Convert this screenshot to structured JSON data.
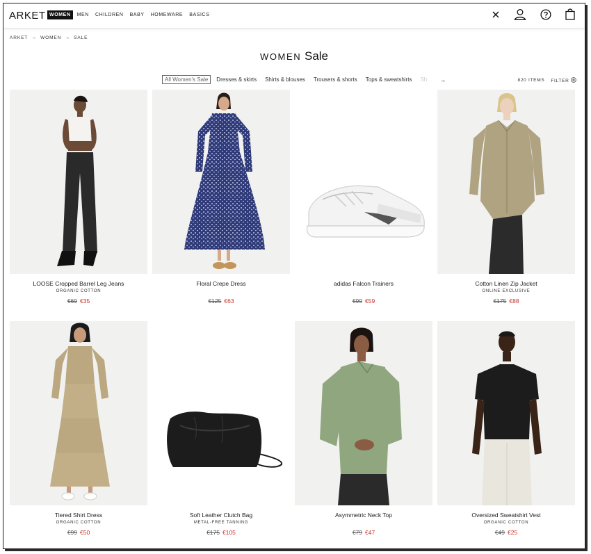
{
  "brand": "ARKET",
  "nav": [
    "WOMEN",
    "MEN",
    "CHILDREN",
    "BABY",
    "HOMEWARE",
    "BASICS"
  ],
  "breadcrumb": [
    "ARKET",
    "WOMEN",
    "SALE"
  ],
  "title": {
    "part1": "WOMEN",
    "part2": "Sale"
  },
  "filters": [
    "All Women's Sale",
    "Dresses & skirts",
    "Shirts & blouses",
    "Trousers & shorts",
    "Tops & sweatshirts",
    "Sh"
  ],
  "items_count": "820 ITEMS",
  "filter_label": "FILTER",
  "colors": {
    "accent": "#111111",
    "sale": "#c8322a",
    "image_bg": "#f1f1f0"
  },
  "products": [
    {
      "name": "LOOSE Cropped Barrel Leg Jeans",
      "sub": "ORGANIC COTTON",
      "old": "€69",
      "new": "€35"
    },
    {
      "name": "Floral Crepe Dress",
      "sub": "",
      "old": "€125",
      "new": "€63"
    },
    {
      "name": "adidas Falcon Trainers",
      "sub": "",
      "old": "€99",
      "new": "€59"
    },
    {
      "name": "Cotton Linen Zip Jacket",
      "sub": "ONLINE EXCLUSIVE",
      "old": "€175",
      "new": "€88"
    },
    {
      "name": "Tiered Shirt Dress",
      "sub": "ORGANIC COTTON",
      "old": "€99",
      "new": "€50"
    },
    {
      "name": "Soft Leather Clutch Bag",
      "sub": "METAL-FREE TANNING",
      "old": "€175",
      "new": "€105"
    },
    {
      "name": "Asymmetric Neck Top",
      "sub": "",
      "old": "€79",
      "new": "€47"
    },
    {
      "name": "Oversized Sweatshirt Vest",
      "sub": "ORGANIC COTTON",
      "old": "€49",
      "new": "€25"
    }
  ]
}
